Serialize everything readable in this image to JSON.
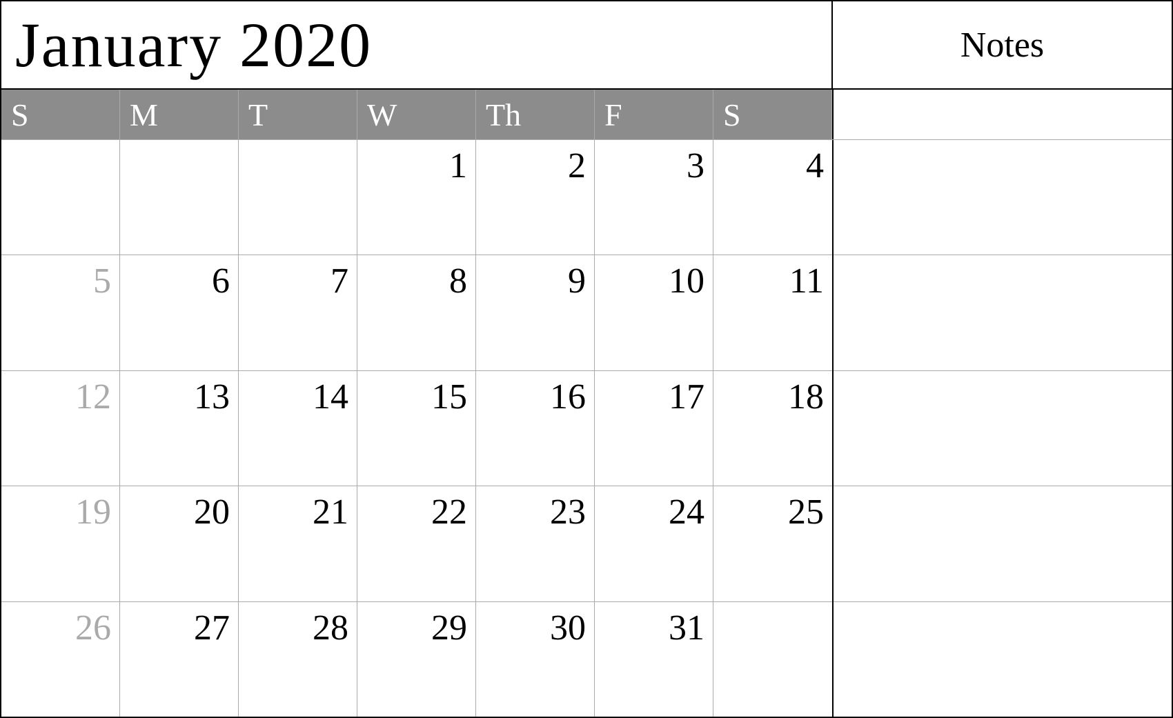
{
  "header": {
    "month_title": "January 2020",
    "notes_label": "Notes"
  },
  "days_of_week": [
    {
      "abbr": "S"
    },
    {
      "abbr": "M"
    },
    {
      "abbr": "T"
    },
    {
      "abbr": "W"
    },
    {
      "abbr": "Th"
    },
    {
      "abbr": "F"
    },
    {
      "abbr": "S"
    }
  ],
  "weeks": [
    [
      {
        "num": "",
        "muted": false,
        "empty": true
      },
      {
        "num": "",
        "muted": false,
        "empty": true
      },
      {
        "num": "",
        "muted": false,
        "empty": true
      },
      {
        "num": "1",
        "muted": false,
        "empty": false
      },
      {
        "num": "2",
        "muted": false,
        "empty": false
      },
      {
        "num": "3",
        "muted": false,
        "empty": false
      },
      {
        "num": "4",
        "muted": false,
        "empty": false
      }
    ],
    [
      {
        "num": "5",
        "muted": true,
        "empty": false
      },
      {
        "num": "6",
        "muted": false,
        "empty": false
      },
      {
        "num": "7",
        "muted": false,
        "empty": false
      },
      {
        "num": "8",
        "muted": false,
        "empty": false
      },
      {
        "num": "9",
        "muted": false,
        "empty": false
      },
      {
        "num": "10",
        "muted": false,
        "empty": false
      },
      {
        "num": "11",
        "muted": false,
        "empty": false
      }
    ],
    [
      {
        "num": "12",
        "muted": true,
        "empty": false
      },
      {
        "num": "13",
        "muted": false,
        "empty": false
      },
      {
        "num": "14",
        "muted": false,
        "empty": false
      },
      {
        "num": "15",
        "muted": false,
        "empty": false
      },
      {
        "num": "16",
        "muted": false,
        "empty": false
      },
      {
        "num": "17",
        "muted": false,
        "empty": false
      },
      {
        "num": "18",
        "muted": false,
        "empty": false
      }
    ],
    [
      {
        "num": "19",
        "muted": true,
        "empty": false
      },
      {
        "num": "20",
        "muted": false,
        "empty": false
      },
      {
        "num": "21",
        "muted": false,
        "empty": false
      },
      {
        "num": "22",
        "muted": false,
        "empty": false
      },
      {
        "num": "23",
        "muted": false,
        "empty": false
      },
      {
        "num": "24",
        "muted": false,
        "empty": false
      },
      {
        "num": "25",
        "muted": false,
        "empty": false
      }
    ],
    [
      {
        "num": "26",
        "muted": true,
        "empty": false
      },
      {
        "num": "27",
        "muted": false,
        "empty": false
      },
      {
        "num": "28",
        "muted": false,
        "empty": false
      },
      {
        "num": "29",
        "muted": false,
        "empty": false
      },
      {
        "num": "30",
        "muted": false,
        "empty": false
      },
      {
        "num": "31",
        "muted": false,
        "empty": false
      },
      {
        "num": "",
        "muted": false,
        "empty": true
      }
    ]
  ]
}
